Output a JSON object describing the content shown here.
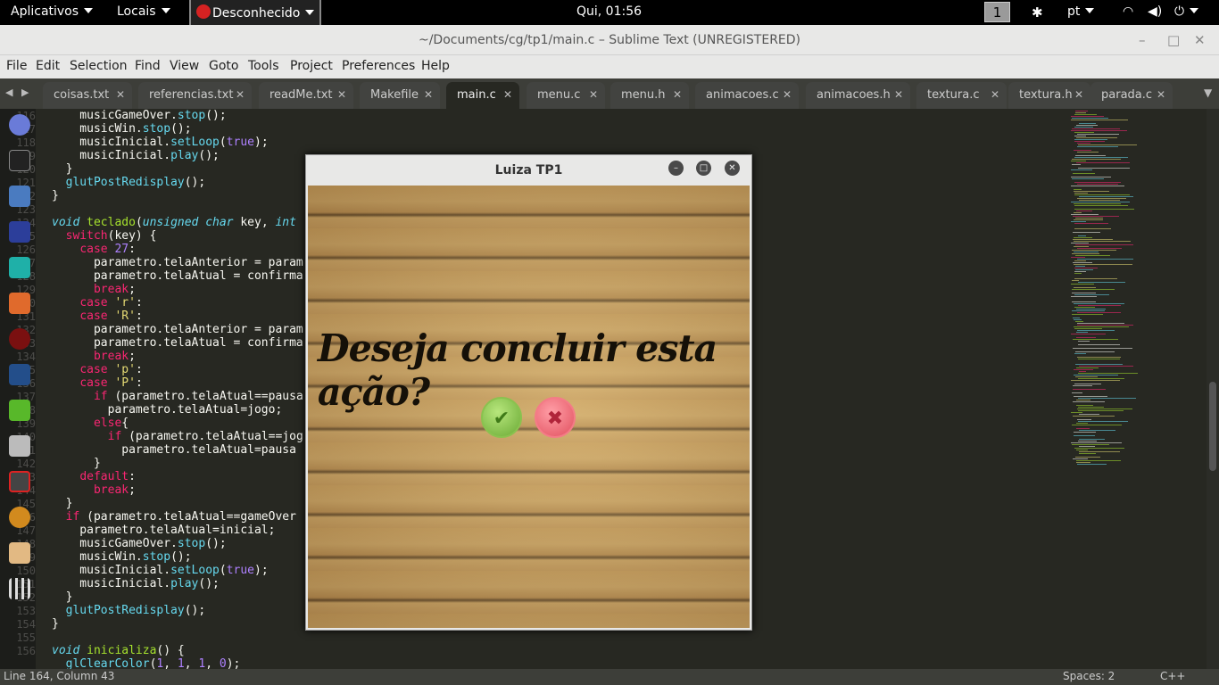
{
  "topbar": {
    "applications": "Aplicativos",
    "places": "Locais",
    "app_name": "Desconhecido",
    "clock": "Qui, 01:56",
    "workspace": "1",
    "language": "pt"
  },
  "window": {
    "title": "~/Documents/cg/tp1/main.c – Sublime Text (UNREGISTERED)"
  },
  "menu": {
    "file": "File",
    "edit": "Edit",
    "selection": "Selection",
    "find": "Find",
    "view": "View",
    "goto": "Goto",
    "tools": "Tools",
    "project": "Project",
    "preferences": "Preferences",
    "help": "Help"
  },
  "tabs": [
    "coisas.txt",
    "referencias.txt",
    "readMe.txt",
    "Makefile",
    "main.c",
    "menu.c",
    "menu.h",
    "animacoes.c",
    "animacoes.h",
    "textura.c",
    "textura.h",
    "parada.c"
  ],
  "active_tab": "main.c",
  "line_numbers": [
    "116",
    "117",
    "118",
    "119",
    "120",
    "121",
    "122",
    "123",
    "124",
    "125",
    "126",
    "127",
    "128",
    "129",
    "130",
    "131",
    "132",
    "133",
    "134",
    "135",
    "136",
    "137",
    "138",
    "139",
    "140",
    "141",
    "142",
    "143",
    "144",
    "145",
    "146",
    "147",
    "148",
    "149",
    "150",
    "151",
    "152",
    "153",
    "154",
    "155",
    "156"
  ],
  "dialog": {
    "title": "Luiza TP1",
    "question": "Deseja concluir esta ação?",
    "confirm_glyph": "✔",
    "cancel_glyph": "✖"
  },
  "status": {
    "position": "Line 164, Column 43",
    "spaces": "Spaces: 2",
    "syntax": "C++"
  }
}
